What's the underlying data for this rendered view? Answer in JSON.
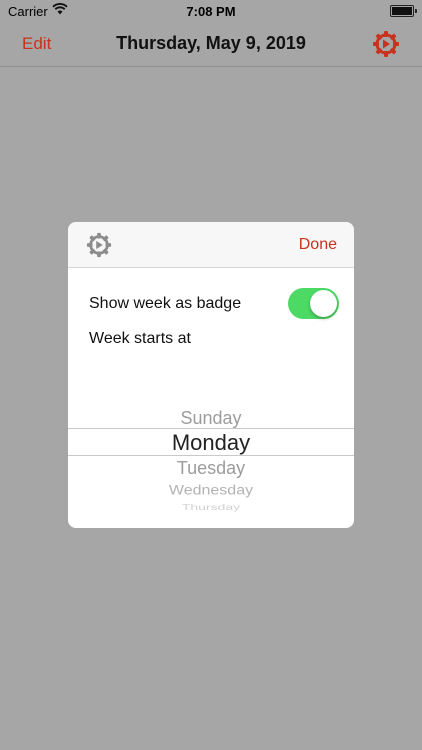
{
  "status_bar": {
    "carrier": "Carrier",
    "time": "7:08 PM",
    "battery_level": 1.0
  },
  "navbar": {
    "edit_label": "Edit",
    "title": "Thursday, May 9, 2019"
  },
  "modal": {
    "done_label": "Done",
    "show_week_label": "Show week as badge",
    "show_week_enabled": true,
    "week_starts_label": "Week starts at",
    "picker": {
      "options": [
        "Sunday",
        "Monday",
        "Tuesday",
        "Wednesday",
        "Thursday"
      ],
      "selected": "Monday"
    }
  },
  "colors": {
    "accent": "#c8321e",
    "toggle_on": "#4cd964",
    "backdrop": "#a6a6a6"
  },
  "icons": {
    "nav_settings": "gear-icon",
    "modal_settings": "gear-icon",
    "wifi": "wifi-icon",
    "battery": "battery-icon"
  }
}
